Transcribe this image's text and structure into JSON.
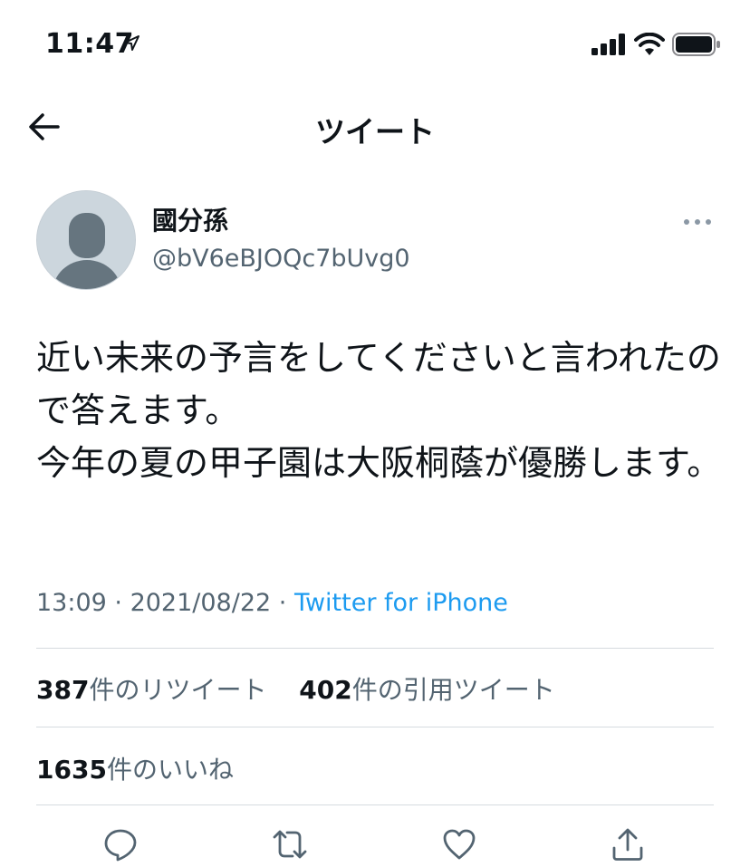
{
  "status_bar": {
    "time": "11:47",
    "icons": [
      "location-arrow-icon",
      "cellular-signal-icon",
      "wifi-icon",
      "battery-icon"
    ]
  },
  "header": {
    "back_icon": "back-arrow-icon",
    "title": "ツイート"
  },
  "tweet": {
    "author": {
      "display_name": "國分孫",
      "handle": "@bV6eBJOQc7bUvg0"
    },
    "more_icon": "more-dots-icon",
    "text": "近い未来の予言をしてくださいと言われたので答えます。\n今年の夏の甲子園は大阪桐蔭が優勝します。",
    "meta": {
      "time": "13:09",
      "sep1": " · ",
      "date": "2021/08/22",
      "sep2": " · ",
      "source": "Twitter for iPhone"
    },
    "stats": {
      "retweets_count": "387",
      "retweets_label": "件のリツイート",
      "quotes_count": "402",
      "quotes_label": "件の引用ツイート",
      "likes_count": "1635",
      "likes_label": "件のいいね"
    },
    "actions": [
      "reply-icon",
      "retweet-icon",
      "like-icon",
      "share-icon"
    ]
  },
  "colors": {
    "accent": "#1d9bf0",
    "secondary_text": "#536471",
    "primary_text": "#0f1419",
    "divider": "#d6dbdf"
  }
}
